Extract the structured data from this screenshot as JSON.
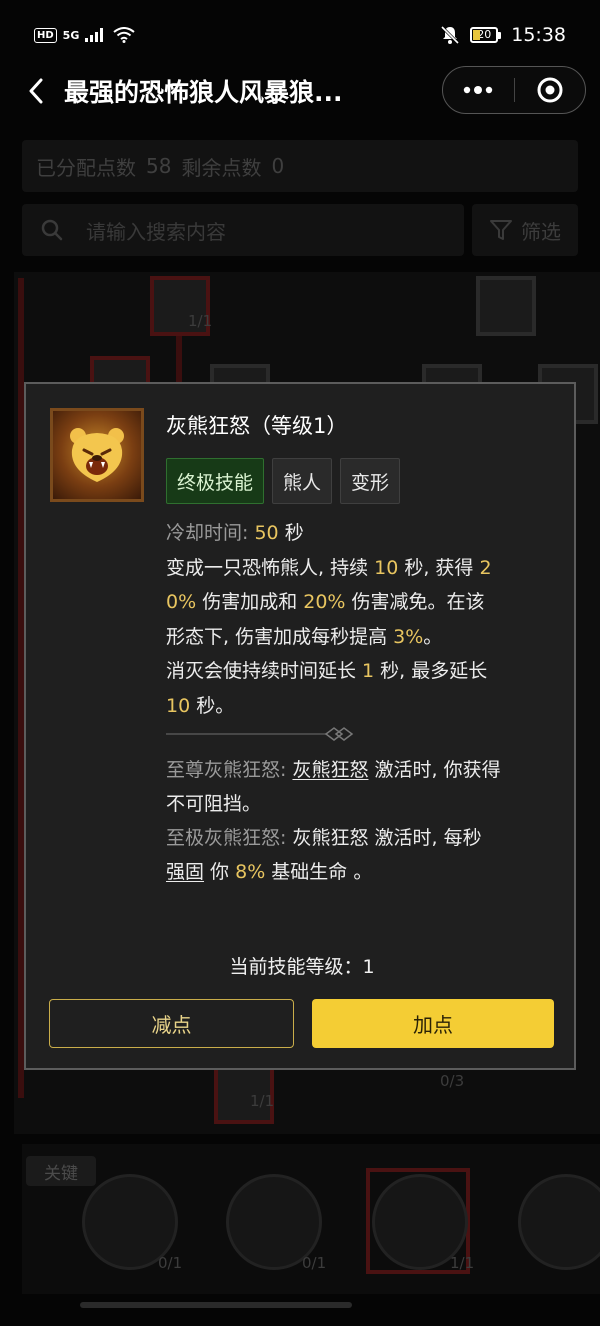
{
  "status_bar": {
    "hd": "HD",
    "network": "5G",
    "battery": "20",
    "time": "15:38"
  },
  "nav": {
    "title": "最强的恐怖狼人风暴狼..."
  },
  "header": {
    "allocated_label": "已分配点数",
    "allocated_value": "58",
    "remaining_label": "剩余点数",
    "remaining_value": "0"
  },
  "search": {
    "placeholder": "请输入搜索内容",
    "filter_label": "筛选"
  },
  "tree": {
    "counts": [
      "1/1",
      "1/1",
      "1/1",
      "0/3"
    ]
  },
  "key_section": {
    "label": "关键",
    "counts": [
      "0/1",
      "0/1",
      "1/1"
    ]
  },
  "popup": {
    "title": "灰熊狂怒（等级1）",
    "tags": [
      "终极技能",
      "熊人",
      "变形"
    ],
    "cooldown_label": "冷却时间:",
    "cooldown_value": "50",
    "cooldown_unit": "秒",
    "desc": {
      "t1": "变成一只恐怖熊人, 持续 ",
      "v1": "10",
      "t2": " 秒, 获得 ",
      "v2a": "2",
      "v2b": "0%",
      "t3": " 伤害加成和 ",
      "v3": "20%",
      "t4": " 伤害减免。在该",
      "t5": "形态下, 伤害加成每秒提高 ",
      "v4": "3%",
      "t6": "。",
      "t7": "消灭会使持续时间延长 ",
      "v5": "1",
      "t8": " 秒, 最多延长",
      "v6": "10",
      "t9": " 秒。"
    },
    "upgrade1": {
      "label": "至尊灰熊狂怒:",
      "skill": "灰熊狂怒",
      "text": " 激活时, 你获得",
      "text2": "不可阻挡。"
    },
    "upgrade2": {
      "label": "至极灰熊狂怒:",
      "skill": "灰熊狂怒",
      "text": " 激活时, 每秒",
      "keyword": "强固",
      "text2": " 你 ",
      "value": "8%",
      "text3": " 基础生命 。"
    },
    "current_level_label": "当前技能等级：",
    "current_level_value": "1",
    "minus_label": "减点",
    "plus_label": "加点"
  },
  "colors": {
    "accent_yellow": "#f4cd34",
    "highlight": "#e8c560",
    "ultimate_tag_bg": "#173a17"
  }
}
